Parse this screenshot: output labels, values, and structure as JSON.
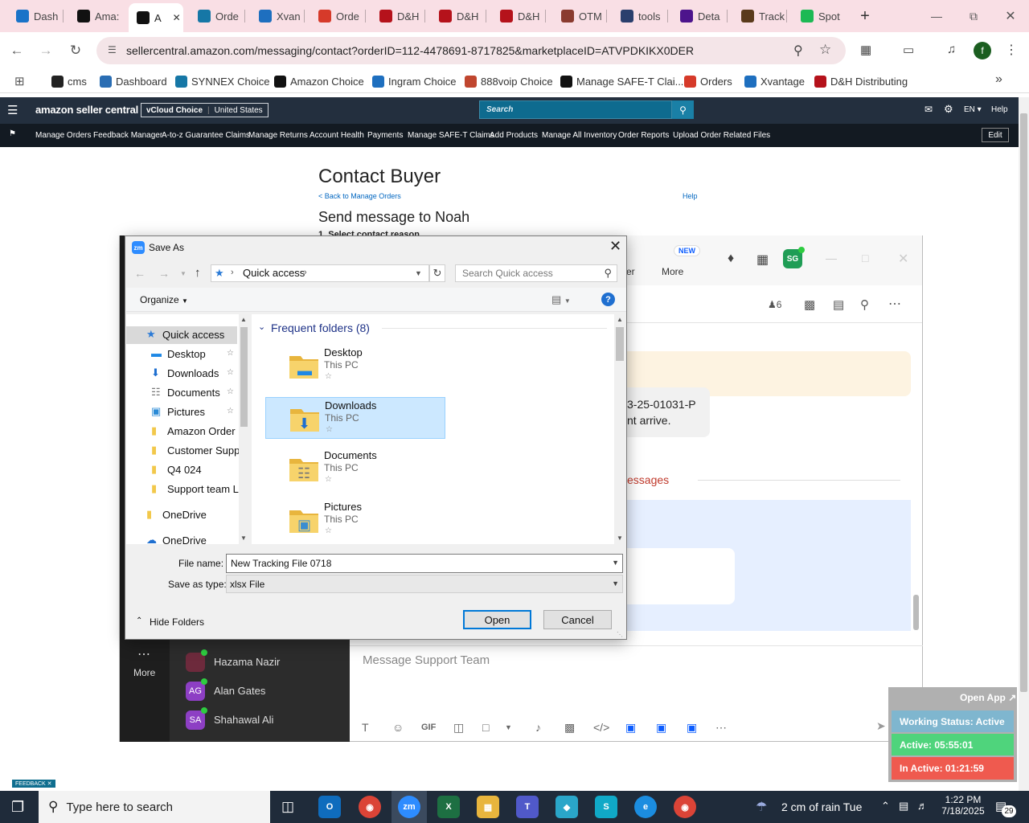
{
  "browser": {
    "tabs": [
      {
        "label": "Dash",
        "color": "#1a73c8"
      },
      {
        "label": "Ama:",
        "color": "#111111"
      },
      {
        "label": "A",
        "color": "#111111"
      },
      {
        "label": "Orde",
        "color": "#1677a6"
      },
      {
        "label": "Xvan",
        "color": "#1e6fbf"
      },
      {
        "label": "Orde",
        "color": "#d63a2a"
      },
      {
        "label": "D&H",
        "color": "#b5121b"
      },
      {
        "label": "D&H",
        "color": "#b5121b"
      },
      {
        "label": "D&H",
        "color": "#b5121b"
      },
      {
        "label": "OTM",
        "color": "#8a3b2f"
      },
      {
        "label": "tools",
        "color": "#2a3f6d"
      },
      {
        "label": "Deta",
        "color": "#4d148c"
      },
      {
        "label": "Track",
        "color": "#5a3a1b"
      },
      {
        "label": "Spot",
        "color": "#1db954"
      }
    ],
    "new_tab": "+",
    "url": "sellercentral.amazon.com/messaging/contact?orderID=112-4478691-8717825&marketplaceID=ATVPDKIKX0DER",
    "profile_initial": "f",
    "bookmarks": [
      {
        "label": "cms",
        "color": "#222222"
      },
      {
        "label": "Dashboard",
        "color": "#2a6db3"
      },
      {
        "label": "SYNNEX Choice",
        "color": "#1677a6"
      },
      {
        "label": "Amazon Choice",
        "color": "#111111"
      },
      {
        "label": "Ingram Choice",
        "color": "#1e6fbf"
      },
      {
        "label": "888voip Choice",
        "color": "#c0462f"
      },
      {
        "label": "Manage SAFE-T Clai...",
        "color": "#111111"
      },
      {
        "label": "Orders",
        "color": "#d63a2a"
      },
      {
        "label": "Xvantage",
        "color": "#1e6fbf"
      },
      {
        "label": "D&H Distributing",
        "color": "#b5121b"
      }
    ]
  },
  "seller_central": {
    "logo": "amazon seller central",
    "store": "vCloud Choice",
    "marketplace": "United States",
    "search_placeholder": "Search",
    "lang": "EN",
    "help": "Help",
    "nav": [
      "Manage Orders",
      "Feedback Manager",
      "A-to-z Guarantee Claims",
      "Manage Returns",
      "Account Health",
      "Payments",
      "Manage SAFE-T Claims",
      "Add Products",
      "Manage All Inventory",
      "Order Reports",
      "Upload Order Related Files"
    ],
    "edit": "Edit",
    "page_title": "Contact Buyer",
    "back_link": "< Back to Manage Orders",
    "help_link": "Help",
    "send_to": "Send message to Noah",
    "step": "1. Select contact reason",
    "feedback_tab": "FEEDBACK"
  },
  "zoom": {
    "new_badge": "NEW",
    "more_label": "More",
    "tab_partial": "er",
    "avatar_initials": "SG",
    "member_count": "6",
    "message_ref": "3-25-01031-P",
    "message_text": "nt arrive.",
    "new_messages": "essages",
    "contacts": [
      {
        "name": "Hazama Nazir",
        "initials": "",
        "color": "#6d2a3c"
      },
      {
        "name": "Alan Gates",
        "initials": "AG",
        "color": "#8d3fc4"
      },
      {
        "name": "Shahawal Ali",
        "initials": "SA",
        "color": "#8d3fc4"
      }
    ],
    "side_more": "More",
    "compose_placeholder": "Message Support Team",
    "gif": "GIF"
  },
  "dialog": {
    "title": "Save As",
    "breadcrumb": "Quick access",
    "search_placeholder": "Search Quick access",
    "organize": "Organize",
    "section": "Frequent folders (8)",
    "nav_items": [
      {
        "label": "Quick access",
        "icon": "star-icon",
        "pinned": false
      },
      {
        "label": "Desktop",
        "icon": "desktop-icon",
        "pinned": true
      },
      {
        "label": "Downloads",
        "icon": "download-icon",
        "pinned": true
      },
      {
        "label": "Documents",
        "icon": "document-icon",
        "pinned": true
      },
      {
        "label": "Pictures",
        "icon": "pictures-icon",
        "pinned": true
      },
      {
        "label": "Amazon Order P",
        "icon": "folder-icon",
        "pinned": false
      },
      {
        "label": "Customer Suppc",
        "icon": "folder-icon",
        "pinned": false
      },
      {
        "label": "Q4 024",
        "icon": "folder-icon",
        "pinned": false
      },
      {
        "label": "Support team Lc",
        "icon": "folder-icon",
        "pinned": false
      },
      {
        "label": "OneDrive",
        "icon": "folder-icon",
        "pinned": false
      },
      {
        "label": "OneDrive",
        "icon": "cloud-icon",
        "pinned": false
      }
    ],
    "folders": [
      {
        "name": "Desktop",
        "location": "This PC"
      },
      {
        "name": "Downloads",
        "location": "This PC"
      },
      {
        "name": "Documents",
        "location": "This PC"
      },
      {
        "name": "Pictures",
        "location": "This PC"
      }
    ],
    "file_name_label": "File name:",
    "file_name_value": "New Tracking File 0718",
    "type_label": "Save as type:",
    "type_value": "xlsx File",
    "hide_folders": "Hide Folders",
    "open": "Open",
    "cancel": "Cancel"
  },
  "status_widget": {
    "open_app": "Open App ↗",
    "working": "Working Status: Active",
    "active": "Active: 05:55:01",
    "inactive": "In Active: 01:21:59"
  },
  "taskbar": {
    "search_placeholder": "Type here to search",
    "weather": "2 cm of rain Tue",
    "time": "1:22 PM",
    "date": "7/18/2025",
    "notifications": "29"
  }
}
